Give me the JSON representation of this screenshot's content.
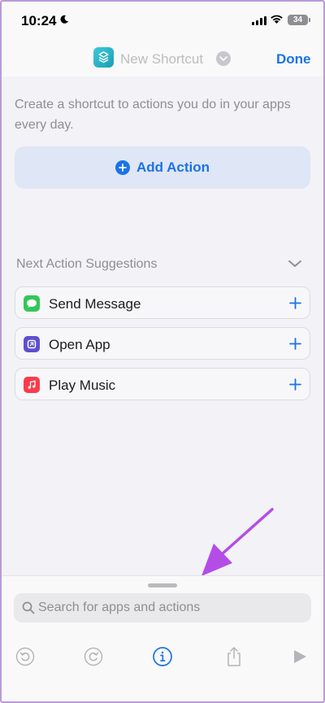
{
  "status_bar": {
    "time": "10:24",
    "battery": "34"
  },
  "nav": {
    "title": "New Shortcut",
    "done_label": "Done"
  },
  "content": {
    "intro": "Create a shortcut to actions you do in your apps every day.",
    "add_action_label": "Add Action"
  },
  "suggestions": {
    "header": "Next Action Suggestions",
    "items": [
      {
        "label": "Send Message",
        "icon": "messages-icon",
        "color": "#34c759"
      },
      {
        "label": "Open App",
        "icon": "open-app-icon",
        "color": "#5e4fd1"
      },
      {
        "label": "Play Music",
        "icon": "music-icon",
        "color": "#fa3c4c"
      }
    ]
  },
  "search": {
    "placeholder": "Search for apps and actions"
  },
  "colors": {
    "accent": "#1a73e8",
    "annotation": "#b44de6"
  }
}
